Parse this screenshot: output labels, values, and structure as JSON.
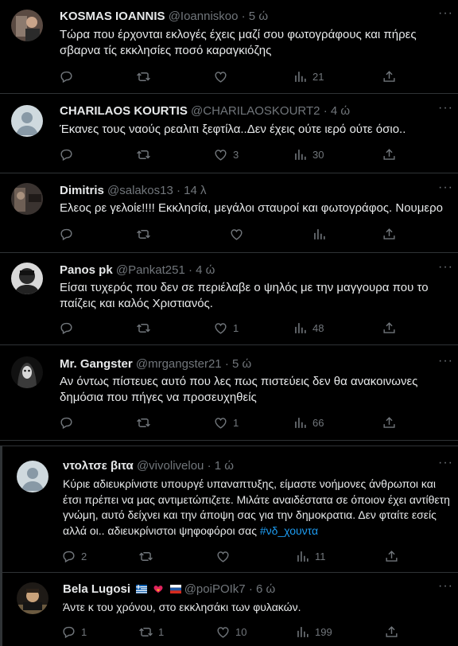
{
  "tweets": [
    {
      "name": "KOSMAS IOANNIS",
      "handle": "@Ioanniskoo",
      "time": "· 5 ώ",
      "text": "Τώρα που έρχονται εκλογές έχεις μαζί σου φωτογράφους και πήρες σβαρνα τίς εκκλησίες ποσό καραγκιόζης",
      "replies": "",
      "retweets": "",
      "likes": "",
      "views": "21"
    },
    {
      "name": "CHARILAOS KOURTIS",
      "handle": "@CHARILAOSKOURT2",
      "time": "· 4 ώ",
      "text": "Έκανες τους ναούς ρεαλιτι ξεφτίλα..Δεν έχεις ούτε ιερό ούτε όσιο..",
      "replies": "",
      "retweets": "",
      "likes": "3",
      "views": "30"
    },
    {
      "name": "Dimitris",
      "handle": "@salakos13",
      "time": "· 14 λ",
      "text": "Ελεος ρε γελοίε!!!! Εκκλησία, μεγάλοι σταυροί και φωτογράφος. Νουμερο",
      "replies": "",
      "retweets": "",
      "likes": "",
      "views": ""
    },
    {
      "name": "Panos pk",
      "handle": "@Pankat251",
      "time": "· 4 ώ",
      "text": "Είσαι τυχερός που δεν σε περιέλαβε ο ψηλός με την μαγγουρα που το παίζεις και καλός Χριστιανός.",
      "replies": "",
      "retweets": "",
      "likes": "1",
      "views": "48"
    },
    {
      "name": "Mr. Gangster",
      "handle": "@mrgangster21",
      "time": "· 5 ώ",
      "text": "Αν όντως πίστευες αυτό που λες πως πιστεύεις δεν θα ανακοινωνες δημόσια που πήγες να προσευχηθείς",
      "replies": "",
      "retweets": "",
      "likes": "1",
      "views": "66"
    },
    {
      "name": "ντολτσε βιτα",
      "handle": "@vivolivelou",
      "time": "· 1 ώ",
      "text": "Κύριε αδιευκρίνιστε υπουργέ υπαναπτυξης, είμαστε νοήμονες άνθρωποι και έτσι πρέπει να μας αντιμετώπιζετε. Μιλάτε αναιδέστατα σε όποιον έχει αντίθετη γνώμη, αυτό δείχνει και την άποψη σας για την δημοκρατια. Δεν φταίτε εσείς αλλά οι.. αδιευκρίνιστοι ψηφοφόροι σας",
      "hashtag": "#νδ_χουντα",
      "replies": "2",
      "retweets": "",
      "likes": "",
      "views": "11"
    },
    {
      "name": "Bela Lugosi",
      "handle": "@poiPOIk7",
      "time": "· 6 ώ",
      "text": "Άντε κ του χρόνου, στο εκκλησάκι των φυλακών.",
      "replies": "1",
      "retweets": "1",
      "likes": "10",
      "views": "199"
    }
  ],
  "more_label": "···",
  "colors": {
    "background": "#000000",
    "text": "#e7e9ea",
    "muted": "#71767b",
    "link": "#1d9bf0",
    "border": "#2f3336"
  },
  "icons": [
    "reply-icon",
    "retweet-icon",
    "like-icon",
    "views-icon",
    "share-icon"
  ]
}
